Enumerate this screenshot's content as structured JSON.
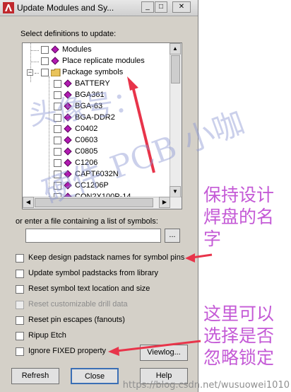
{
  "window": {
    "title": "Update Modules and Sy...",
    "controls": {
      "minimize": "_",
      "maximize": "□",
      "close": "✕"
    }
  },
  "select_label": "Select definitions to update:",
  "tree": {
    "items": [
      {
        "label": "Modules",
        "level": 1,
        "icon": "diamond-icon",
        "checked": false
      },
      {
        "label": "Place replicate modules",
        "level": 1,
        "icon": "diamond-icon",
        "checked": false
      },
      {
        "label": "Package symbols",
        "level": 1,
        "icon": "folder-icon",
        "checked": false,
        "expanded": true
      },
      {
        "label": "BATTERY",
        "level": 2,
        "icon": "diamond-icon",
        "checked": false
      },
      {
        "label": "BGA361",
        "level": 2,
        "icon": "diamond-icon",
        "checked": false
      },
      {
        "label": "BGA-63",
        "level": 2,
        "icon": "diamond-icon",
        "checked": false
      },
      {
        "label": "BGA-DDR2",
        "level": 2,
        "icon": "diamond-icon",
        "checked": false
      },
      {
        "label": "C0402",
        "level": 2,
        "icon": "diamond-icon",
        "checked": false
      },
      {
        "label": "C0603",
        "level": 2,
        "icon": "diamond-icon",
        "checked": false
      },
      {
        "label": "C0805",
        "level": 2,
        "icon": "diamond-icon",
        "checked": false
      },
      {
        "label": "C1206",
        "level": 2,
        "icon": "diamond-icon",
        "checked": false
      },
      {
        "label": "CAPT6032N",
        "level": 2,
        "icon": "diamond-icon",
        "checked": false
      },
      {
        "label": "CC1206P",
        "level": 2,
        "icon": "diamond-icon",
        "checked": false
      },
      {
        "label": "CON2X100P-14",
        "level": 2,
        "icon": "diamond-icon",
        "checked": false
      }
    ]
  },
  "file_label": "or enter a file containing a list of symbols:",
  "file_input_value": "",
  "browse_label": "...",
  "options": [
    {
      "label": "Keep design padstack names for symbol pins",
      "checked": false,
      "disabled": false
    },
    {
      "label": "Update symbol padstacks from library",
      "checked": false,
      "disabled": false
    },
    {
      "label": "Reset symbol text location and size",
      "checked": false,
      "disabled": false
    },
    {
      "label": "Reset customizable drill data",
      "checked": false,
      "disabled": true
    },
    {
      "label": "Reset pin escapes (fanouts)",
      "checked": false,
      "disabled": false
    },
    {
      "label": "Ripup Etch",
      "checked": false,
      "disabled": false
    },
    {
      "label": "Ignore FIXED property",
      "checked": false,
      "disabled": false
    }
  ],
  "viewlog_label": "Viewlog...",
  "buttons": {
    "refresh": "Refresh",
    "close": "Close",
    "help": "Help"
  },
  "annotations": {
    "note_top": "保持设计焊盘的名字",
    "note_bottom": "这里可以选择是否忽略锁定",
    "arrow_color": "#e8344a",
    "note_color": "#c45ad6"
  },
  "watermarks": {
    "big_a": "头像号：",
    "big_b": "硬件 PCB 小咖",
    "small": "https://blog.csdn.net/wusuowei1010"
  },
  "colors": {
    "dialog_bg": "#d4d0c8",
    "symbol_diamond": "#b21ab2"
  }
}
